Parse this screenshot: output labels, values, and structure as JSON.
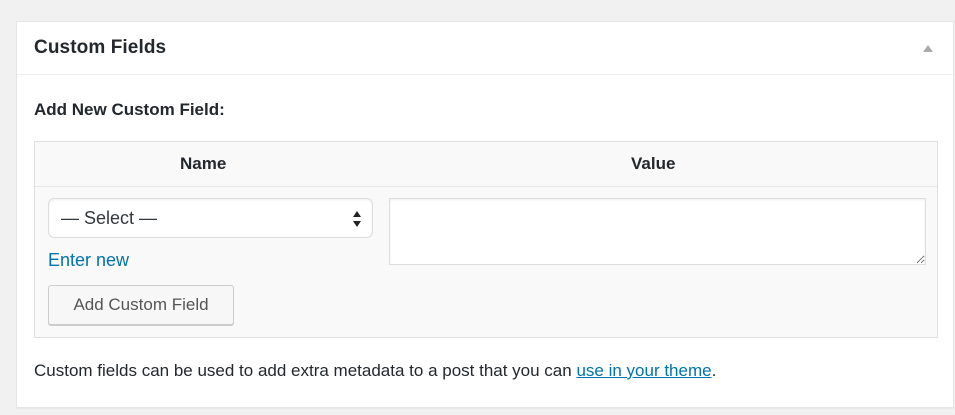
{
  "metabox": {
    "title": "Custom Fields",
    "toggle_icon": "triangle-up-icon"
  },
  "form": {
    "add_new_heading": "Add New Custom Field:",
    "columns": {
      "name": "Name",
      "value": "Value"
    },
    "name_select": {
      "selected": "— Select —",
      "icon": "select-arrows-icon"
    },
    "enter_new_link": "Enter new",
    "value_textarea": {
      "value": ""
    },
    "add_button": "Add Custom Field"
  },
  "help": {
    "text_before": "Custom fields can be used to add extra metadata to a post that you can ",
    "link_text": "use in your theme",
    "text_after": "."
  },
  "colors": {
    "link": "#0073aa",
    "background": "#f1f1f1",
    "panel": "#ffffff",
    "table_bg": "#f9f9f9"
  }
}
